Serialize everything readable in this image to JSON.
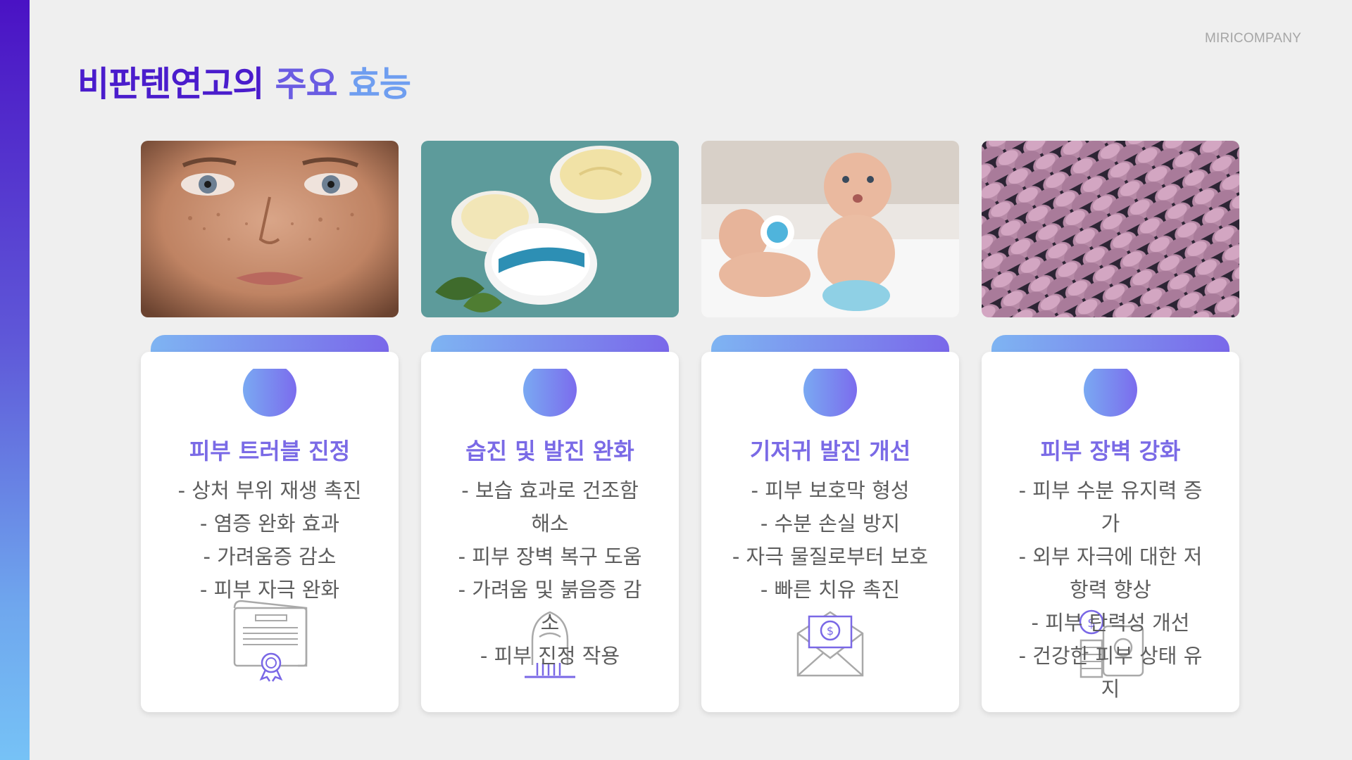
{
  "brand": "MIRICOMPANY",
  "title": {
    "part1": "비판텐연고의",
    "part2": "주요",
    "part3": "효능"
  },
  "cards": [
    {
      "image": "woman-face-freckles",
      "title": "피부 트러블 진정",
      "items": [
        "- 상처 부위 재생 촉진",
        "- 염증 완화 효과",
        "- 가려움증 감소",
        "- 피부 자극 완화"
      ],
      "icon": "certificate-icon"
    },
    {
      "image": "bepanthen-cream-jars",
      "title": "습진 및 발진 완화",
      "items": [
        "- 보습 효과로 건조함 해소",
        "- 피부 장벽 복구 도움",
        "- 가려움 및 붉음증 감소",
        "- 피부 진정 작용"
      ],
      "icon": "hand-press-icon"
    },
    {
      "image": "babies-on-bed",
      "title": "기저귀 발진 개선",
      "items": [
        "- 피부 보호막 형성",
        "- 수분 손실 방지",
        "- 자극 물질로부터 보호",
        "- 빠른 치유 촉진"
      ],
      "icon": "money-envelope-icon"
    },
    {
      "image": "scale-texture",
      "title": "피부 장벽 강화",
      "items": [
        "- 피부 수분 유지력 증가",
        "- 외부 자극에 대한 저항력 향상",
        "- 피부 탄력성 개선",
        "- 건강한 피부 상태 유지"
      ],
      "icon": "money-safe-icon"
    }
  ]
}
